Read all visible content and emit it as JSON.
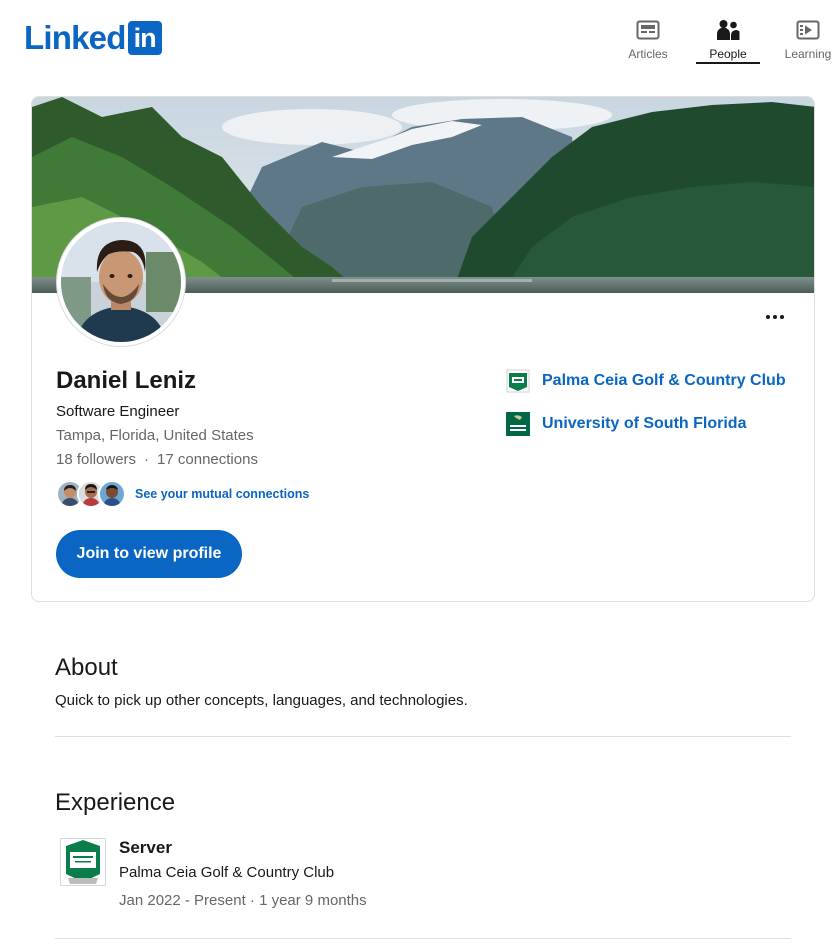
{
  "header": {
    "logo_text": "Linked",
    "logo_box": "in",
    "nav": [
      {
        "label": "Articles",
        "icon": "articles-icon"
      },
      {
        "label": "People",
        "icon": "people-icon",
        "active": true
      },
      {
        "label": "Learning",
        "icon": "learning-icon"
      }
    ]
  },
  "profile": {
    "name": "Daniel Leniz",
    "headline": "Software Engineer",
    "location": "Tampa, Florida, United States",
    "followers": "18 followers",
    "separator": "·",
    "connections": "17 connections",
    "mutual_link": "See your mutual connections",
    "join_button": "Join to view profile",
    "more_icon": "more-options-icon",
    "organizations": [
      {
        "name": "Palma Ceia Golf & Country Club",
        "color": "#0a7d4a"
      },
      {
        "name": "University of South Florida",
        "color": "#006747"
      }
    ]
  },
  "about": {
    "title": "About",
    "text": "Quick to pick up other concepts, languages, and technologies."
  },
  "experience": {
    "title": "Experience",
    "items": [
      {
        "role": "Server",
        "company": "Palma Ceia Golf & Country Club",
        "dates": "Jan 2022 - Present · 1 year 9 months"
      }
    ]
  },
  "colors": {
    "brand": "#0a66c2",
    "text": "#191919",
    "muted": "#666666",
    "border": "#e0dfdc"
  }
}
